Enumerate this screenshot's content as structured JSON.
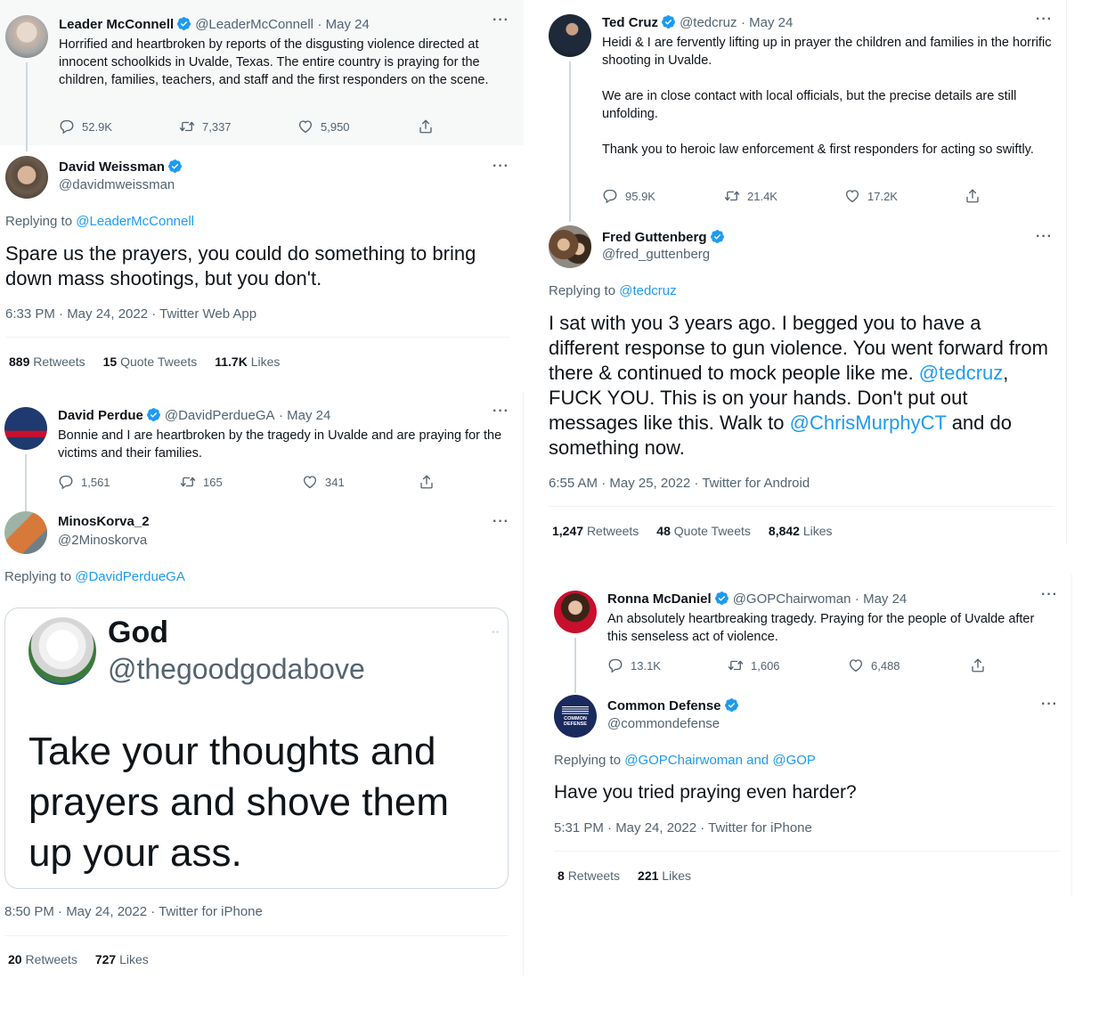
{
  "colors": {
    "link": "#1d9bf0",
    "verified": "#1d9bf0",
    "secondary": "#536471"
  },
  "mcconnell": {
    "name": "Leader McConnell",
    "handle": "@LeaderMcConnell",
    "date": "· May 24",
    "text": "Horrified and heartbroken by reports of the disgusting violence directed at innocent schoolkids in Uvalde, Texas. The entire country is praying for the children, families, teachers, and staff and the first responders on the scene.",
    "replies": "52.9K",
    "retweets": "7,337",
    "likes": "5,950"
  },
  "weissman": {
    "name": "David Weissman",
    "handle": "@davidmweissman",
    "replying_label": "Replying to",
    "replying_to": "@LeaderMcConnell",
    "text": "Spare us the prayers, you could do something to bring down mass shootings, but you don't.",
    "meta": "6:33 PM · May 24, 2022 · Twitter Web App",
    "retweets_count": "889",
    "retweets_label": "Retweets",
    "quotes_count": "15",
    "quotes_label": "Quote Tweets",
    "likes_count": "11.7K",
    "likes_label": "Likes"
  },
  "perdue": {
    "name": "David Perdue",
    "handle": "@DavidPerdueGA",
    "date": "· May 24",
    "text": "Bonnie and I are heartbroken by the tragedy in Uvalde and are praying for the victims and their families.",
    "replies": "1,561",
    "retweets": "165",
    "likes": "341"
  },
  "minos": {
    "name": "MinosKorva_2",
    "handle": "@2Minoskorva",
    "replying_label": "Replying to",
    "replying_to": "@DavidPerdueGA",
    "meta": "8:50 PM · May 24, 2022 · Twitter for iPhone",
    "retweets_count": "20",
    "retweets_label": "Retweets",
    "likes_count": "727",
    "likes_label": "Likes",
    "embed": {
      "name": "God",
      "handle": "@thegoodgodabove",
      "text": "Take your thoughts and prayers and shove them up your ass."
    }
  },
  "cruz": {
    "name": "Ted Cruz",
    "handle": "@tedcruz",
    "date": "· May 24",
    "p1": "Heidi & I are fervently lifting up in prayer the children and families in the horrific shooting in Uvalde.",
    "p2": "We are in close contact with local officials, but the precise details are still unfolding.",
    "p3": "Thank you to heroic law enforcement & first responders for acting so swiftly.",
    "replies": "95.9K",
    "retweets": "21.4K",
    "likes": "17.2K"
  },
  "guttenberg": {
    "name": "Fred Guttenberg",
    "handle": "@fred_guttenberg",
    "replying_label": "Replying to",
    "replying_to": "@tedcruz",
    "t1": "I sat with you 3 years ago.  I begged you to have a different response to gun violence.  You went forward from there & continued to mock people like me.  ",
    "mention1": "@tedcruz",
    "t2": ", FUCK YOU.  This is on your hands.  Don't put out messages like this.  Walk to ",
    "mention2": "@ChrisMurphyCT",
    "t3": " and  do something now.",
    "meta": "6:55 AM · May 25, 2022 · Twitter for Android",
    "retweets_count": "1,247",
    "retweets_label": "Retweets",
    "quotes_count": "48",
    "quotes_label": "Quote Tweets",
    "likes_count": "8,842",
    "likes_label": "Likes"
  },
  "mcdaniel": {
    "name": "Ronna McDaniel",
    "handle": "@GOPChairwoman",
    "date": "· May 24",
    "text": "An absolutely heartbreaking tragedy. Praying for the people of Uvalde after this senseless act of violence.",
    "replies": "13.1K",
    "retweets": "1,606",
    "likes": "6,488"
  },
  "common": {
    "name": "Common Defense",
    "handle": "@commondefense",
    "avatar_text": "COMMON DEFENSE",
    "replying_label": "Replying to",
    "replying_to": "@GOPChairwoman and @GOP",
    "text": "Have you tried praying even harder?",
    "meta": "5:31 PM · May 24, 2022 · Twitter for iPhone",
    "retweets_count": "8",
    "retweets_label": "Retweets",
    "likes_count": "221",
    "likes_label": "Likes"
  }
}
